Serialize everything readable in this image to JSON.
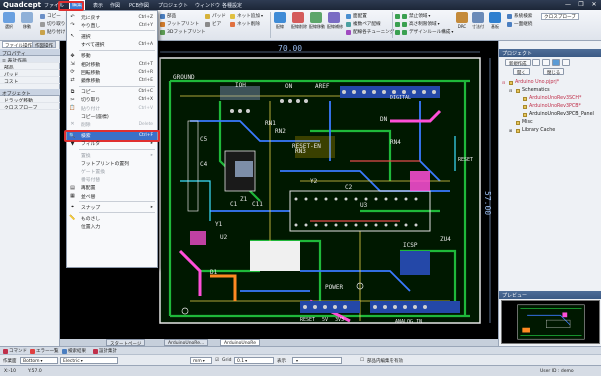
{
  "app": {
    "logo": "Quadcept",
    "menus": [
      "ファイル",
      "編集",
      "表示",
      "作図",
      "PCB作図",
      "プロジェクト",
      "ウィンドウ",
      "各種設定"
    ],
    "active_menu": "編集",
    "window_controls": [
      "—",
      "❐",
      "✕"
    ]
  },
  "ribbon": {
    "left_buttons": [
      "選択",
      "移動"
    ],
    "clipboard": [
      "コピー",
      "切り取り",
      "貼り付け"
    ],
    "edit_shortcuts": [
      "Ctrl+Z",
      "Ctrl+Y"
    ],
    "place": [
      "部品",
      "フットプリント",
      "3Dフットプリント"
    ],
    "misc": [
      "パッド",
      "ビア"
    ],
    "net": [
      "ネット追加",
      "ネット削除"
    ],
    "route": [
      "配線",
      "配線削除",
      "配線移動",
      "配線補修"
    ],
    "route_small": [
      "面配置",
      "複数ペア配線",
      "配線各チューニング"
    ],
    "dfm": [
      "禁止領域",
      "高さ制限領域",
      "デザインルール構成"
    ],
    "rule_buttons": [
      "DRC",
      "寸法付"
    ],
    "far_right": [
      "基板",
      "系統",
      "外形"
    ],
    "right_small": [
      "系統検索",
      "一面継続"
    ],
    "search_box": "クロスプローブ"
  },
  "left_panel": {
    "tabs": [
      "ファイル操作",
      "作図操作"
    ],
    "property_header": "プロパティ",
    "property_rows": [
      "≡ 表計作画",
      "部品",
      "パッド",
      "コスト"
    ],
    "object_header": "オブジェクト",
    "object_rows": [
      "ドラッグ移動",
      "クロスプローブ"
    ]
  },
  "edit_menu": {
    "items": [
      {
        "icon": "undo-icon",
        "glyph": "↶",
        "label": "元に戻す",
        "shortcut": "Ctrl+Z",
        "disabled": false
      },
      {
        "icon": "redo-icon",
        "glyph": "↷",
        "label": "やり直し",
        "shortcut": "Ctrl+Y",
        "disabled": false
      },
      {
        "sep": true
      },
      {
        "icon": "select-icon",
        "glyph": "↖",
        "label": "選択",
        "shortcut": "",
        "disabled": false
      },
      {
        "icon": "select-all-icon",
        "glyph": "",
        "label": "すべて選択",
        "shortcut": "Ctrl+A",
        "disabled": false
      },
      {
        "sep": true
      },
      {
        "icon": "move-icon",
        "glyph": "✥",
        "label": "移動",
        "shortcut": "",
        "disabled": false
      },
      {
        "icon": "relative-move-icon",
        "glyph": "⇲",
        "label": "相対移動",
        "shortcut": "Ctrl+T",
        "disabled": false
      },
      {
        "icon": "rotate-icon",
        "glyph": "⟳",
        "label": "回転移動",
        "shortcut": "Ctrl+R",
        "disabled": false
      },
      {
        "icon": "mirror-icon",
        "glyph": "⇄",
        "label": "鏡像移動",
        "shortcut": "Ctrl+E",
        "disabled": false
      },
      {
        "sep": true
      },
      {
        "icon": "copy-icon",
        "glyph": "⧉",
        "label": "コピー",
        "shortcut": "Ctrl+C",
        "disabled": false
      },
      {
        "icon": "cut-icon",
        "glyph": "✂",
        "label": "切り取り",
        "shortcut": "Ctrl+X",
        "disabled": false
      },
      {
        "icon": "paste-icon",
        "glyph": "📋",
        "label": "貼り付け",
        "shortcut": "Ctrl+V",
        "disabled": true
      },
      {
        "icon": "copy-special-icon",
        "glyph": "",
        "label": "コピー(座標)",
        "shortcut": "",
        "disabled": false
      },
      {
        "icon": "delete-icon",
        "glyph": "✕",
        "label": "削除",
        "shortcut": "Delete",
        "disabled": true
      },
      {
        "sep": true
      },
      {
        "icon": "search-icon",
        "glyph": "🔍",
        "label": "検索",
        "shortcut": "Ctrl+F",
        "disabled": false,
        "highlight": true
      },
      {
        "icon": "filter-icon",
        "glyph": "▼",
        "label": "フィルタ",
        "shortcut": "",
        "disabled": false,
        "submenu": true
      },
      {
        "sep": true
      },
      {
        "icon": "replace-icon",
        "glyph": "",
        "label": "置換",
        "shortcut": "",
        "disabled": true,
        "submenu": true
      },
      {
        "icon": "replace-fp-icon",
        "glyph": "",
        "label": "フットプリントの置列",
        "shortcut": "",
        "disabled": false
      },
      {
        "icon": "swap-gate-icon",
        "glyph": "",
        "label": "ゲート置換",
        "shortcut": "",
        "disabled": true
      },
      {
        "icon": "swap-pin-icon",
        "glyph": "",
        "label": "番号付替",
        "shortcut": "",
        "disabled": true
      },
      {
        "icon": "align-icon",
        "glyph": "▤",
        "label": "再配置",
        "shortcut": "",
        "disabled": false
      },
      {
        "icon": "arrange-icon",
        "glyph": "▦",
        "label": "並べ替",
        "shortcut": "",
        "disabled": false
      },
      {
        "sep": true
      },
      {
        "icon": "snap-icon",
        "glyph": "⌖",
        "label": "スナップ",
        "shortcut": "",
        "disabled": false,
        "submenu": true
      },
      {
        "sep": true
      },
      {
        "icon": "measure-icon",
        "glyph": "📏",
        "label": "ものさし",
        "shortcut": "",
        "disabled": false
      },
      {
        "icon": "view-icon",
        "glyph": "",
        "label": "位置入力",
        "shortcut": "",
        "disabled": false
      }
    ]
  },
  "canvas": {
    "dimension_top": "70.00",
    "dimension_right": "57.00",
    "labels": [
      "GROUND",
      "IOH",
      "ON",
      "AREF",
      "RN1",
      "RN2",
      "RN3",
      "RN4",
      "RESET-EN",
      "DN",
      "C5",
      "C4",
      "C1",
      "C11",
      "C2",
      "Y1",
      "Y2",
      "Z1",
      "D1",
      "U2",
      "U3",
      "ICSP",
      "POWER",
      "DIGITAL",
      "ANALOG IN",
      "RESET",
      "ZU4",
      "RESET",
      "5V",
      "3V3"
    ]
  },
  "doc_tabs": [
    "スタートページ",
    "ArduinoUnoRe...",
    "ArduinoUnoRe"
  ],
  "right_panel": {
    "title": "プロジェクト",
    "buttons": [
      "新規作成",
      "開く",
      "閉じる"
    ],
    "tree": [
      {
        "label": "Arduino Uno.pjprj*",
        "indent": 0,
        "color": "#c0304a",
        "toggle": "⊟"
      },
      {
        "label": "Schematics",
        "indent": 1,
        "color": "#222",
        "toggle": "⊟"
      },
      {
        "label": "ArduinoUnoRev3SCH*",
        "indent": 2,
        "color": "#c0304a",
        "toggle": ""
      },
      {
        "label": "ArduinoUnoRev3PCB*",
        "indent": 2,
        "color": "#c0304a",
        "toggle": ""
      },
      {
        "label": "ArduinoUnoRev3PCB_Panel",
        "indent": 2,
        "color": "#222",
        "toggle": ""
      },
      {
        "label": "Misc",
        "indent": 1,
        "color": "#222",
        "toggle": ""
      },
      {
        "label": "Library Cache",
        "indent": 1,
        "color": "#222",
        "toggle": "⊞"
      }
    ],
    "preview_title": "プレビュー"
  },
  "status_tabs": [
    "コマンド",
    "エラー一覧",
    "検索結果",
    "設計集計"
  ],
  "options_bar": {
    "work_layer_label": "作業面",
    "work_layer": "Bottom",
    "net_value": "Electric",
    "unit": "mm",
    "grid_label": "Grid",
    "grid_value": "0.1",
    "grid_checked": true,
    "display_label": "表示",
    "edit_label": "部品内編集を有効"
  },
  "coords": {
    "x": "X:-10",
    "y": "Y:57.0",
    "user": "User ID : demo"
  },
  "colors": {
    "accent": "#3b71c9",
    "highlight_box": "#e03030",
    "canvas_bg": "#000000"
  }
}
